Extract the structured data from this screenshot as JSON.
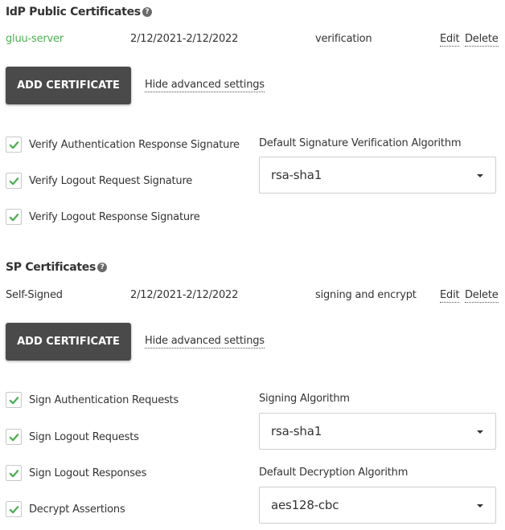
{
  "idp": {
    "title": "IdP Public Certificates",
    "help_glyph": "?",
    "cert": {
      "name": "gluu-server",
      "dates": "2/12/2021-2/12/2022",
      "usage": "verification",
      "edit": "Edit",
      "delete": "Delete"
    },
    "add_button": "ADD CERTIFICATE",
    "advanced_link": "Hide advanced settings",
    "checks": [
      {
        "label": "Verify Authentication Response Signature",
        "checked": true
      },
      {
        "label": "Verify Logout Request Signature",
        "checked": true
      },
      {
        "label": "Verify Logout Response Signature",
        "checked": true
      }
    ],
    "algorithm": {
      "label": "Default Signature Verification Algorithm",
      "value": "rsa-sha1"
    }
  },
  "sp": {
    "title": "SP Certificates",
    "help_glyph": "?",
    "cert": {
      "name": "Self-Signed",
      "dates": "2/12/2021-2/12/2022",
      "usage": "signing and encrypt",
      "edit": "Edit",
      "delete": "Delete"
    },
    "add_button": "ADD CERTIFICATE",
    "advanced_link": "Hide advanced settings",
    "checks": [
      {
        "label": "Sign Authentication Requests",
        "checked": true
      },
      {
        "label": "Sign Logout Requests",
        "checked": true
      },
      {
        "label": "Sign Logout Responses",
        "checked": true
      },
      {
        "label": "Decrypt Assertions",
        "checked": true
      }
    ],
    "signing_algorithm": {
      "label": "Signing Algorithm",
      "value": "rsa-sha1"
    },
    "decryption_algorithm": {
      "label": "Default Decryption Algorithm",
      "value": "aes128-cbc"
    }
  },
  "colors": {
    "button_bg": "#4a4a4a",
    "check_green": "#4caf50",
    "link_green": "#4caf50"
  },
  "icons": {
    "help": "question-circle-icon",
    "check": "checkmark-icon",
    "caret": "caret-down-icon"
  }
}
